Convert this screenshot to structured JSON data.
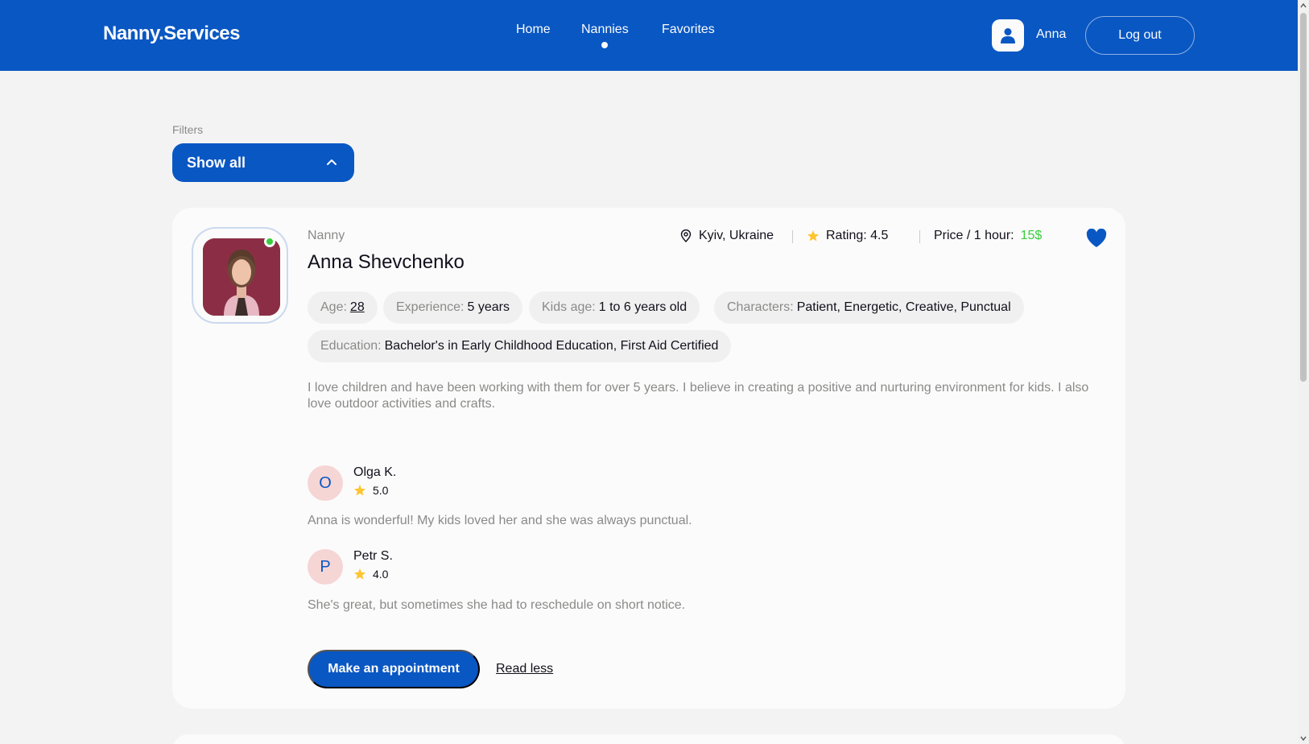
{
  "header": {
    "logo": "Nanny.Services",
    "nav": [
      {
        "label": "Home",
        "active": false
      },
      {
        "label": "Nannies",
        "active": true
      },
      {
        "label": "Favorites",
        "active": false
      }
    ],
    "user_name": "Anna",
    "logout_label": "Log out"
  },
  "filters": {
    "label": "Filters",
    "selected": "Show all",
    "icon": "chevron-up-icon"
  },
  "nanny": {
    "role": "Nanny",
    "name": "Anna Shevchenko",
    "online": true,
    "location": "Kyiv, Ukraine",
    "rating_label": "Rating: 4.5",
    "price_label": "Price / 1 hour:",
    "price_value": "15$",
    "favorite": true,
    "chips": {
      "age_key": "Age:",
      "age_val": "28",
      "exp_key": "Experience:",
      "exp_val": "5 years",
      "kids_key": "Kids age:",
      "kids_val": "1 to 6 years old",
      "char_key": "Characters:",
      "char_val": "Patient, Energetic, Creative, Punctual",
      "edu_key": "Education:",
      "edu_val": "Bachelor's in Early Childhood Education, First Aid Certified"
    },
    "about": "I love children and have been working with them for over 5 years. I believe in creating a positive and nurturing environment for kids. I also love outdoor activities and crafts.",
    "reviews": [
      {
        "initial": "O",
        "name": "Olga K.",
        "rating": "5.0",
        "text": "Anna is wonderful! My kids loved her and she was always punctual."
      },
      {
        "initial": "P",
        "name": "Petr S.",
        "rating": "4.0",
        "text": "She's great, but sometimes she had to reschedule on short notice."
      }
    ],
    "appointment_label": "Make an appointment",
    "read_less_label": "Read less"
  },
  "colors": {
    "primary": "#0957c3",
    "background": "#f3f3f3",
    "card": "#fbfbfb",
    "online": "#38cd3e",
    "price": "#38cd3e",
    "star": "#ffc531",
    "review_avatar_bg": "#f6d5d5"
  }
}
